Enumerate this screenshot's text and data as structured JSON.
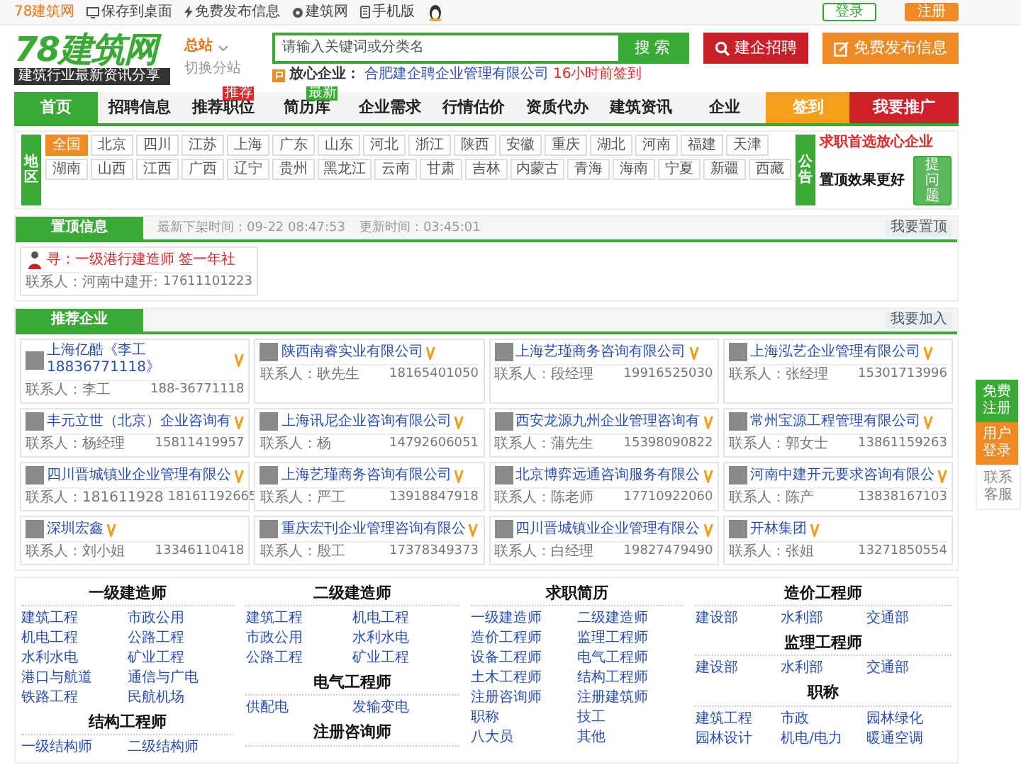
{
  "topbar": {
    "site_name": "78建筑网",
    "links": [
      {
        "kind": "desktop",
        "label": "保存到桌面"
      },
      {
        "kind": "publish",
        "label": "免费发布信息"
      },
      {
        "kind": "site",
        "label": "建筑网"
      },
      {
        "kind": "mobile",
        "label": "手机版"
      }
    ],
    "login": "登录",
    "register": "注册"
  },
  "header": {
    "logo": "78建筑网",
    "tagline": "建筑行业最新资讯分享",
    "station": "总站",
    "switch_station": "切换分站",
    "search": {
      "placeholder": "请输入关键词或分类名",
      "button": "搜 索"
    },
    "trusted_label": "放心企业：",
    "trusted_company": "合肥建企聘企业管理有限公司",
    "trusted_time": "16小时前签到",
    "recruit_button": "建企招聘",
    "publish_button": "免费发布信息"
  },
  "nav": [
    {
      "label": "首页",
      "kind": "link",
      "selected": true
    },
    {
      "label": "招聘信息",
      "kind": "link",
      "selected": false
    },
    {
      "label": "推荐职位",
      "kind": "link",
      "selected": false,
      "badge": {
        "text": "推荐",
        "color": "#e02828"
      }
    },
    {
      "label": "简历库",
      "kind": "link",
      "selected": false,
      "badge": {
        "text": "最新",
        "color": "#3aaa35"
      }
    },
    {
      "label": "企业需求",
      "kind": "link",
      "selected": false
    },
    {
      "label": "行情估价",
      "kind": "link",
      "selected": false
    },
    {
      "label": "资质代办",
      "kind": "link",
      "selected": false
    },
    {
      "label": "建筑资讯",
      "kind": "link",
      "selected": false
    },
    {
      "label": "企业",
      "kind": "link",
      "selected": false
    },
    {
      "label": "签到",
      "kind": "signin",
      "selected": false
    },
    {
      "label": "我要推广",
      "kind": "promo",
      "selected": false
    }
  ],
  "region": {
    "label": "地区",
    "rows": [
      [
        {
          "label": "全国",
          "selected": true
        },
        {
          "label": "北京",
          "selected": false
        },
        {
          "label": "四川",
          "selected": false
        },
        {
          "label": "江苏",
          "selected": false
        },
        {
          "label": "上海",
          "selected": false
        },
        {
          "label": "广东",
          "selected": false
        },
        {
          "label": "山东",
          "selected": false
        },
        {
          "label": "河北",
          "selected": false
        },
        {
          "label": "浙江",
          "selected": false
        },
        {
          "label": "陕西",
          "selected": false
        },
        {
          "label": "安徽",
          "selected": false
        },
        {
          "label": "重庆",
          "selected": false
        },
        {
          "label": "湖北",
          "selected": false
        },
        {
          "label": "河南",
          "selected": false
        },
        {
          "label": "福建",
          "selected": false
        },
        {
          "label": "天津",
          "selected": false
        }
      ],
      [
        {
          "label": "湖南",
          "selected": false
        },
        {
          "label": "山西",
          "selected": false
        },
        {
          "label": "江西",
          "selected": false
        },
        {
          "label": "广西",
          "selected": false
        },
        {
          "label": "辽宁",
          "selected": false
        },
        {
          "label": "贵州",
          "selected": false
        },
        {
          "label": "黑龙江",
          "selected": false
        },
        {
          "label": "云南",
          "selected": false
        },
        {
          "label": "甘肃",
          "selected": false
        },
        {
          "label": "吉林",
          "selected": false
        },
        {
          "label": "内蒙古",
          "selected": false
        },
        {
          "label": "青海",
          "selected": false
        },
        {
          "label": "海南",
          "selected": false
        },
        {
          "label": "宁夏",
          "selected": false
        },
        {
          "label": "新疆",
          "selected": false
        },
        {
          "label": "西藏",
          "selected": false
        }
      ]
    ]
  },
  "notice": {
    "label": "公告",
    "headline": "求职首选放心企业",
    "text": "置顶效果更好",
    "button": "提问题"
  },
  "top_info": {
    "title": "置顶信息",
    "latest_removed": "最新下架时间：09-22 08:47:53",
    "updated": "更新时间：03:45:01",
    "button": "我要置顶",
    "items": [
      {
        "title": "寻：一级港行建造师 签一年社",
        "contact": "联系人：河南中建开:",
        "phone": "17611101223"
      }
    ]
  },
  "recommended": {
    "title": "推荐企业",
    "button": "我要加入",
    "items": [
      {
        "name": "上海亿酷《李工18836771118》",
        "contact": "联系人：李工",
        "phone": "188-36771118"
      },
      {
        "name": "陕西南睿实业有限公司",
        "contact": "联系人：耿先生",
        "phone": "18165401050"
      },
      {
        "name": "上海艺瑾商务咨询有限公司",
        "contact": "联系人：段经理",
        "phone": "19916525030"
      },
      {
        "name": "上海泓艺企业管理有限公司",
        "contact": "联系人：张经理",
        "phone": "15301713996"
      },
      {
        "name": "丰元立世（北京）企业咨询有",
        "contact": "联系人：杨经理",
        "phone": "15811419957"
      },
      {
        "name": "上海讯尼企业咨询有限公司",
        "contact": "联系人：杨",
        "phone": "14792606051"
      },
      {
        "name": "西安龙源九州企业管理咨询有",
        "contact": "联系人：蒲先生",
        "phone": "15398090822"
      },
      {
        "name": "常州宝源工程管理有限公司",
        "contact": "联系人：郭女士",
        "phone": "13861159263"
      },
      {
        "name": "四川晋城镇业企业管理有限公",
        "contact": "联系人：181611928",
        "phone": "18161192665"
      },
      {
        "name": "上海艺瑾商务咨询有限公司",
        "contact": "联系人：严工",
        "phone": "13918847918"
      },
      {
        "name": "北京博弈远通咨询服务有限公",
        "contact": "联系人：陈老师",
        "phone": "17710922060"
      },
      {
        "name": "河南中建开元要求咨询有限公",
        "contact": "联系人：陈产",
        "phone": "13838167103"
      },
      {
        "name": "深圳宏鑫",
        "contact": "联系人：刘小姐",
        "phone": "13346110418"
      },
      {
        "name": "重庆宏刊企业管理咨询有限公",
        "contact": "联系人：殷工",
        "phone": "17378349373"
      },
      {
        "name": "四川晋城镇业企业管理有限公",
        "contact": "联系人：白经理",
        "phone": "19827479490"
      },
      {
        "name": "开林集团",
        "contact": "联系人：张姐",
        "phone": "13271850554"
      }
    ]
  },
  "categories": [
    [
      {
        "title": "一级建造师",
        "links": [
          "建筑工程",
          "市政公用",
          "机电工程",
          "公路工程",
          "水利水电",
          "矿业工程",
          "港口与航道",
          "通信与广电",
          "铁路工程",
          "民航机场"
        ]
      },
      {
        "title": "结构工程师",
        "links": [
          "一级结构师",
          "二级结构师"
        ]
      }
    ],
    [
      {
        "title": "二级建造师",
        "links": [
          "建筑工程",
          "机电工程",
          "市政公用",
          "水利水电",
          "公路工程",
          "矿业工程"
        ]
      },
      {
        "title": "电气工程师",
        "links": [
          "供配电",
          "发输变电"
        ]
      },
      {
        "title": "注册咨询师"
      }
    ],
    [
      {
        "title": "求职简历",
        "links": [
          "一级建造师",
          "二级建造师",
          "造价工程师",
          "监理工程师",
          "设备工程师",
          "电气工程师",
          "土木工程师",
          "结构工程师",
          "注册咨询师",
          "注册建筑师",
          "职称",
          "技工",
          "八大员",
          "其他"
        ]
      }
    ],
    [
      {
        "title": "造价工程师",
        "links": [
          "建设部",
          "水利部",
          "交通部"
        ]
      },
      {
        "title": "监理工程师",
        "links": [
          "建设部",
          "水利部",
          "交通部"
        ]
      },
      {
        "title": "职称",
        "links": [
          "建筑工程",
          "市政",
          "园林绿化",
          "园林设计",
          "机电/电力",
          "暖通空调"
        ]
      }
    ]
  ],
  "side_float": [
    {
      "label": "免费注册",
      "kind": "register"
    },
    {
      "label": "用户登录",
      "kind": "login"
    },
    {
      "label": "联系客服",
      "kind": "service"
    }
  ]
}
